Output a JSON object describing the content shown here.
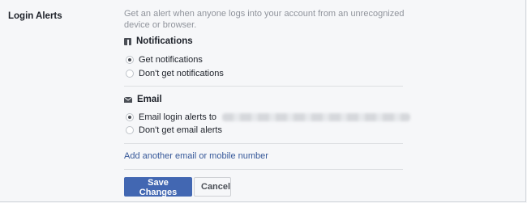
{
  "section": {
    "title": "Login Alerts",
    "description": "Get an alert when anyone logs into your account from an unrecognized device or browser."
  },
  "notifications": {
    "heading": "Notifications",
    "icon": "facebook-icon",
    "options": [
      {
        "label": "Get notifications",
        "selected": true
      },
      {
        "label": "Don't get notifications",
        "selected": false
      }
    ]
  },
  "email": {
    "heading": "Email",
    "icon": "mail-icon",
    "options": [
      {
        "label": "Email login alerts to",
        "selected": true
      },
      {
        "label": "Don't get email alerts",
        "selected": false
      }
    ]
  },
  "add_contact_link": "Add another email or mobile number",
  "buttons": {
    "save": "Save Changes",
    "cancel": "Cancel"
  },
  "colors": {
    "primary": "#4267b2",
    "link": "#365899",
    "muted_text": "#90949c"
  }
}
